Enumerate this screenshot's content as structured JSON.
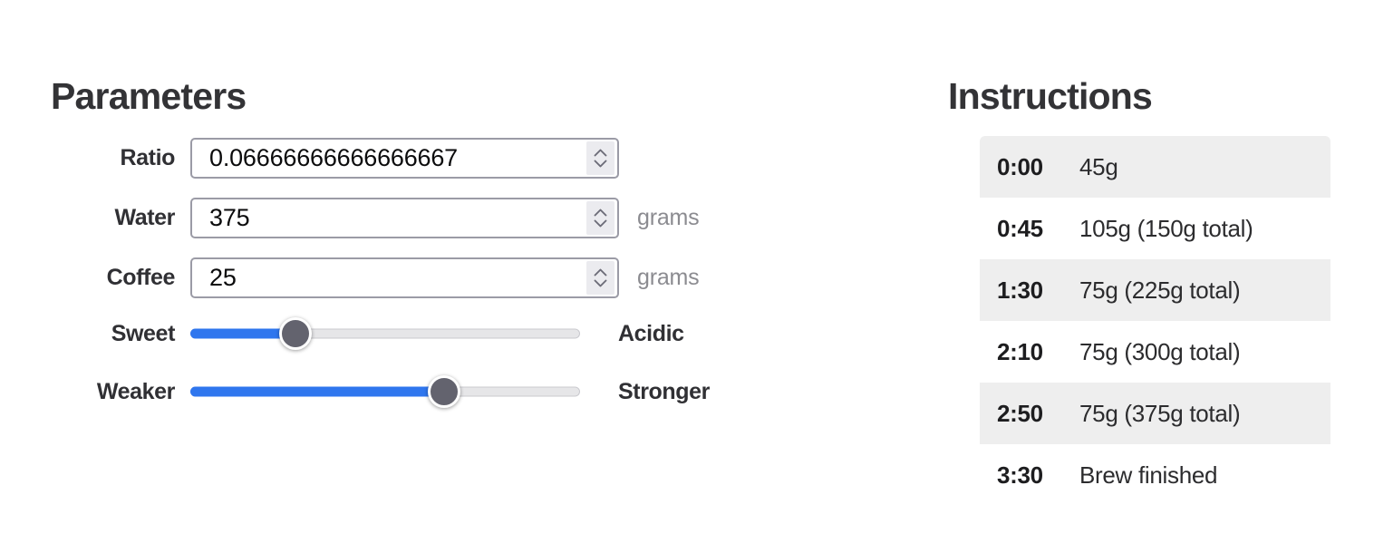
{
  "parameters": {
    "title": "Parameters",
    "fields": [
      {
        "label": "Ratio",
        "value": "0.06666666666666667",
        "unit": "",
        "type": "number",
        "spinner_up_icon": "chevron-up-icon",
        "spinner_down_icon": "chevron-down-icon"
      },
      {
        "label": "Water",
        "value": "375",
        "unit": "grams",
        "type": "number",
        "spinner_up_icon": "chevron-up-icon",
        "spinner_down_icon": "chevron-down-icon"
      },
      {
        "label": "Coffee",
        "value": "25",
        "unit": "grams",
        "type": "number",
        "spinner_up_icon": "chevron-up-icon",
        "spinner_down_icon": "chevron-down-icon"
      }
    ],
    "sliders": [
      {
        "left_label": "Sweet",
        "right_label": "Acidic",
        "percent": 27
      },
      {
        "left_label": "Weaker",
        "right_label": "Stronger",
        "percent": 65
      }
    ]
  },
  "instructions": {
    "title": "Instructions",
    "steps": [
      {
        "time": "0:00",
        "action": "45g"
      },
      {
        "time": "0:45",
        "action": "105g (150g total)"
      },
      {
        "time": "1:30",
        "action": "75g (225g total)"
      },
      {
        "time": "2:10",
        "action": "75g (300g total)"
      },
      {
        "time": "2:50",
        "action": "75g (375g total)"
      },
      {
        "time": "3:30",
        "action": "Brew finished"
      }
    ]
  },
  "colors": {
    "accent_blue": "#2f76ee",
    "slider_thumb": "#63636e",
    "track_gray": "#e6e6e8",
    "row_shade": "#eeeeee",
    "heading": "#333336",
    "unit_text": "#8b8b90",
    "input_border": "#9b9ba6",
    "spinner_bg": "#ebebef"
  }
}
